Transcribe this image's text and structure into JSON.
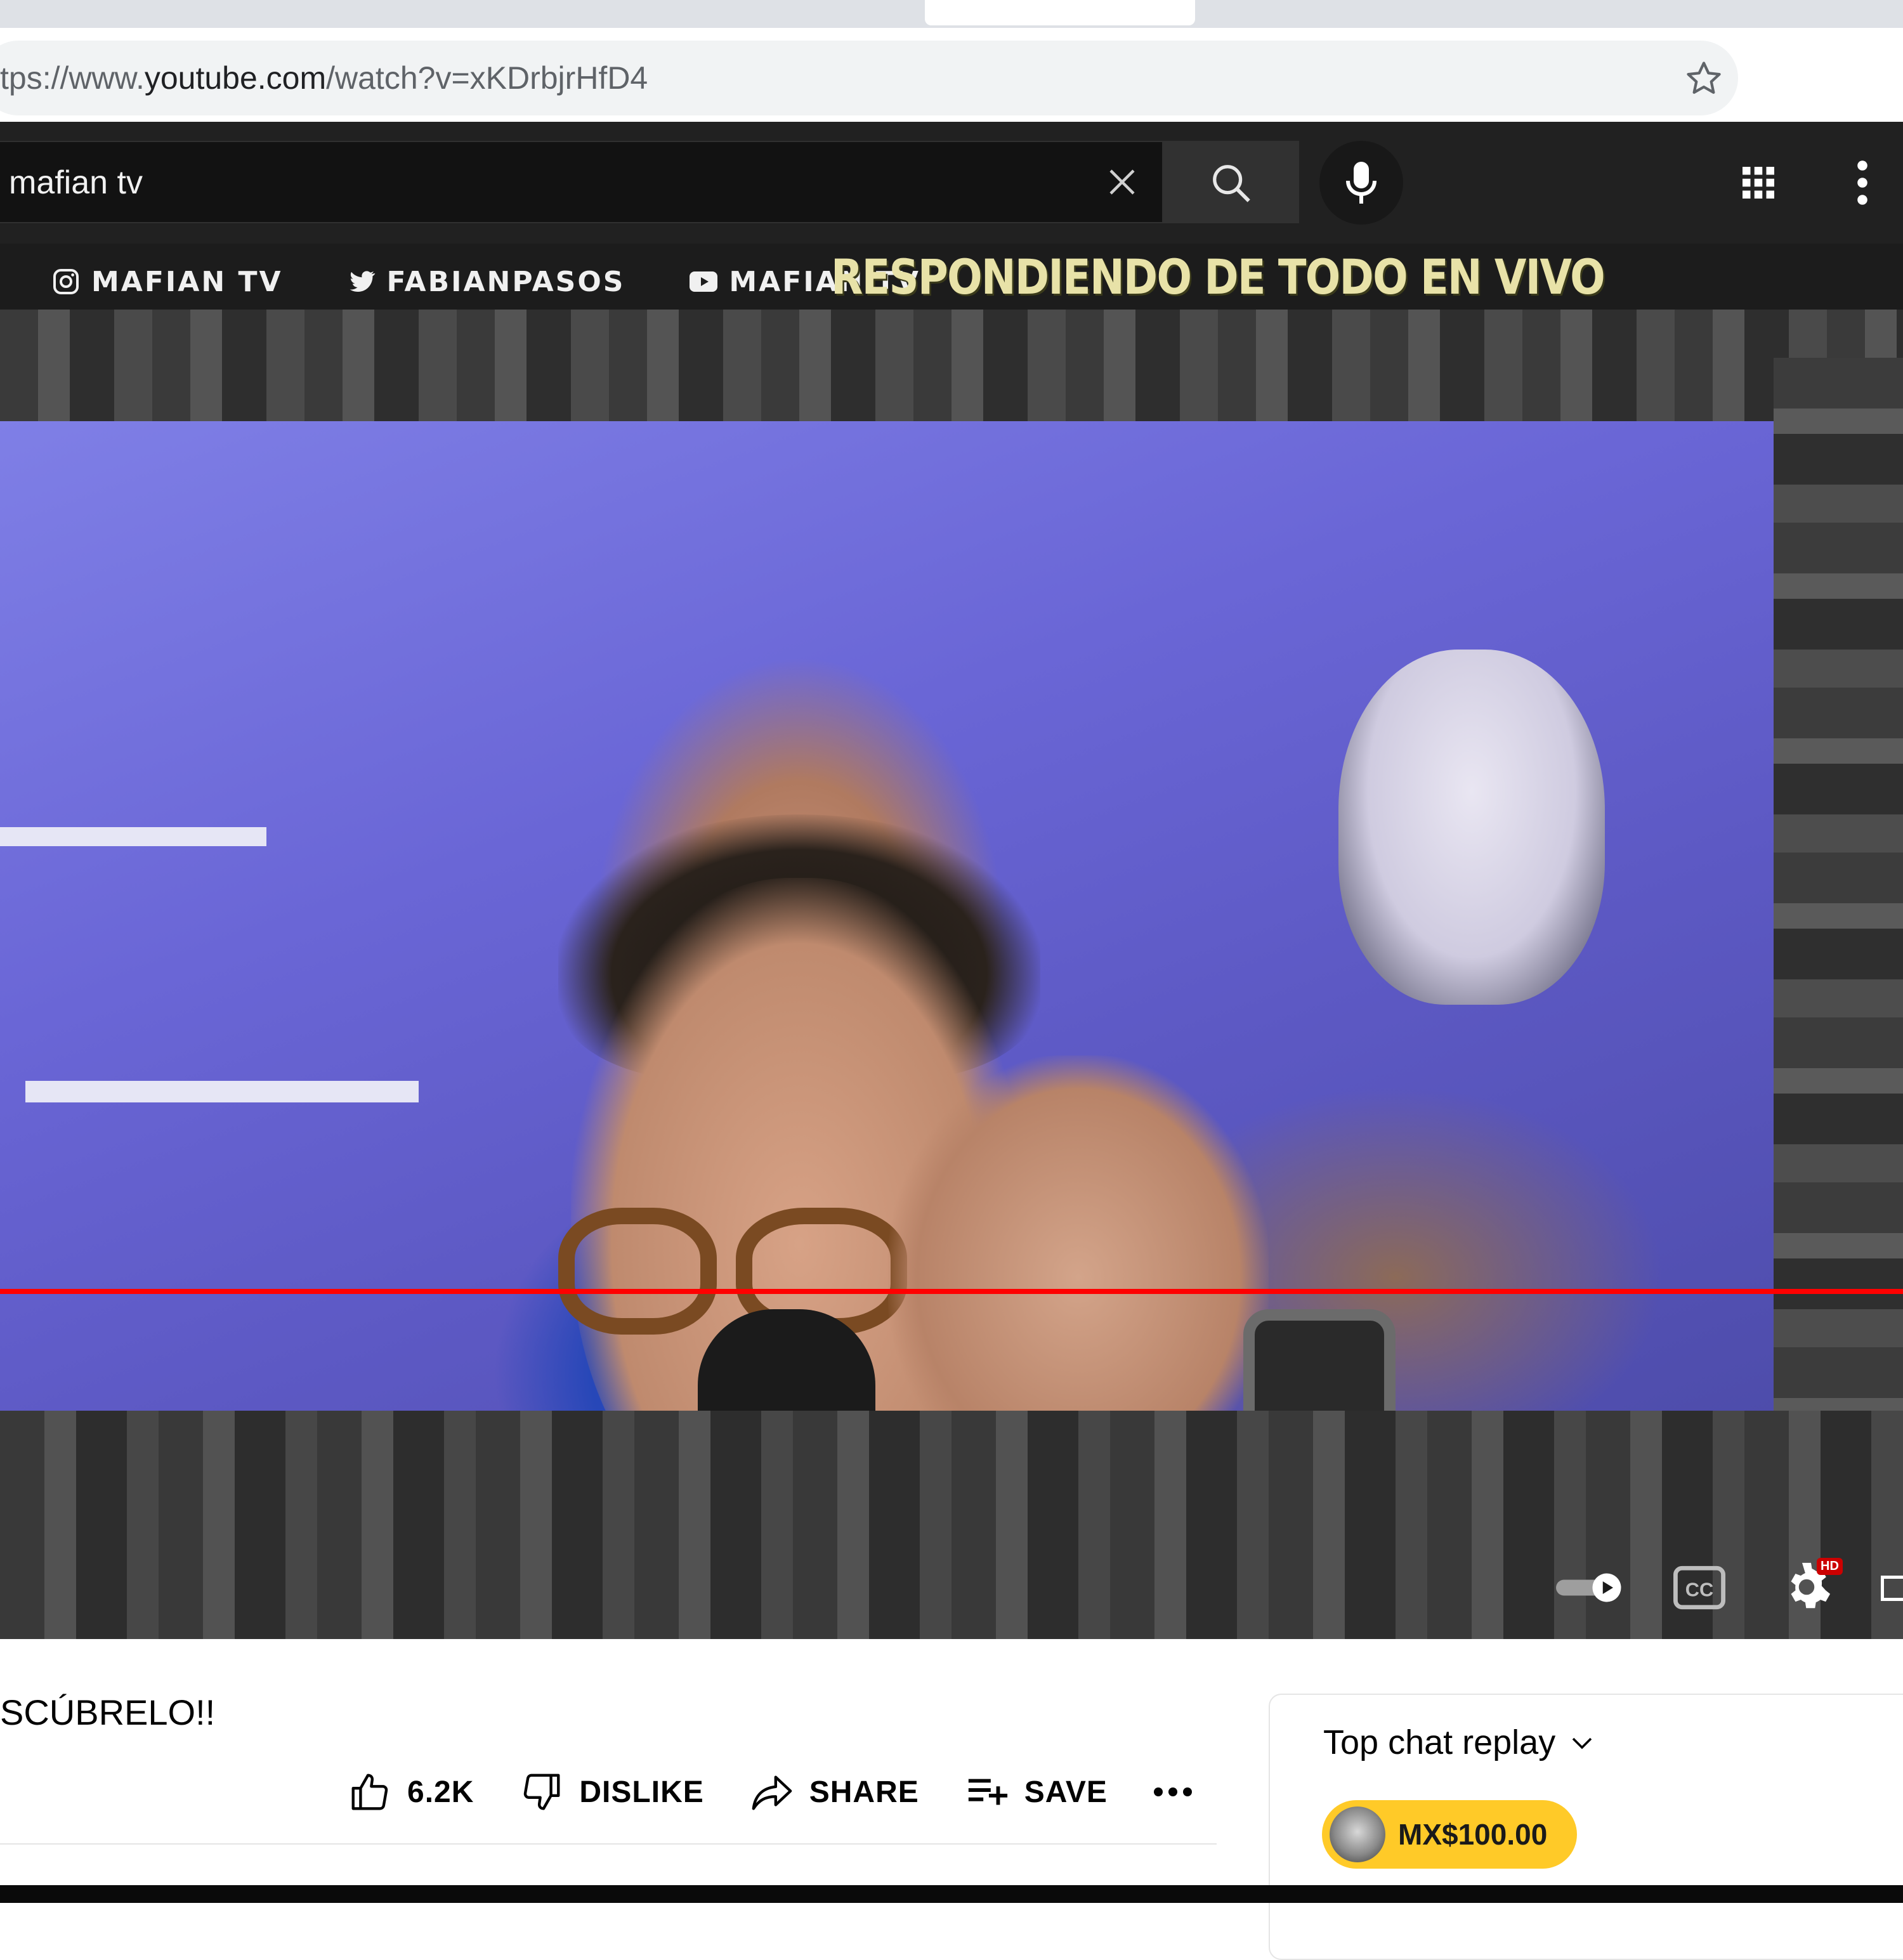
{
  "browser": {
    "url_prefix": "tps://www.",
    "url_host": "youtube.com",
    "url_path": "/watch?v=xKDrbjrHfD4"
  },
  "search": {
    "query": "mafian tv"
  },
  "video": {
    "social": [
      {
        "icon": "instagram-icon",
        "label": "MAFIAN TV"
      },
      {
        "icon": "twitter-icon",
        "label": "FABIANPASOS"
      },
      {
        "icon": "youtube-icon",
        "label": "MAFIAN TV"
      }
    ],
    "banner": "RESPONDIENDO DE TODO EN VIVO",
    "progress_fraction": 1.0,
    "hd_badge": "HD",
    "colors": {
      "progress": "#ff0000",
      "banner_text": "#e8e2a8"
    }
  },
  "title": "SCÚBRELO!!",
  "actions": {
    "like_count": "6.2K",
    "dislike_label": "DISLIKE",
    "share_label": "SHARE",
    "save_label": "SAVE"
  },
  "chat": {
    "title": "Top chat replay",
    "superchat_amount": "MX$100.00",
    "superchat_color": "#ffca28"
  }
}
